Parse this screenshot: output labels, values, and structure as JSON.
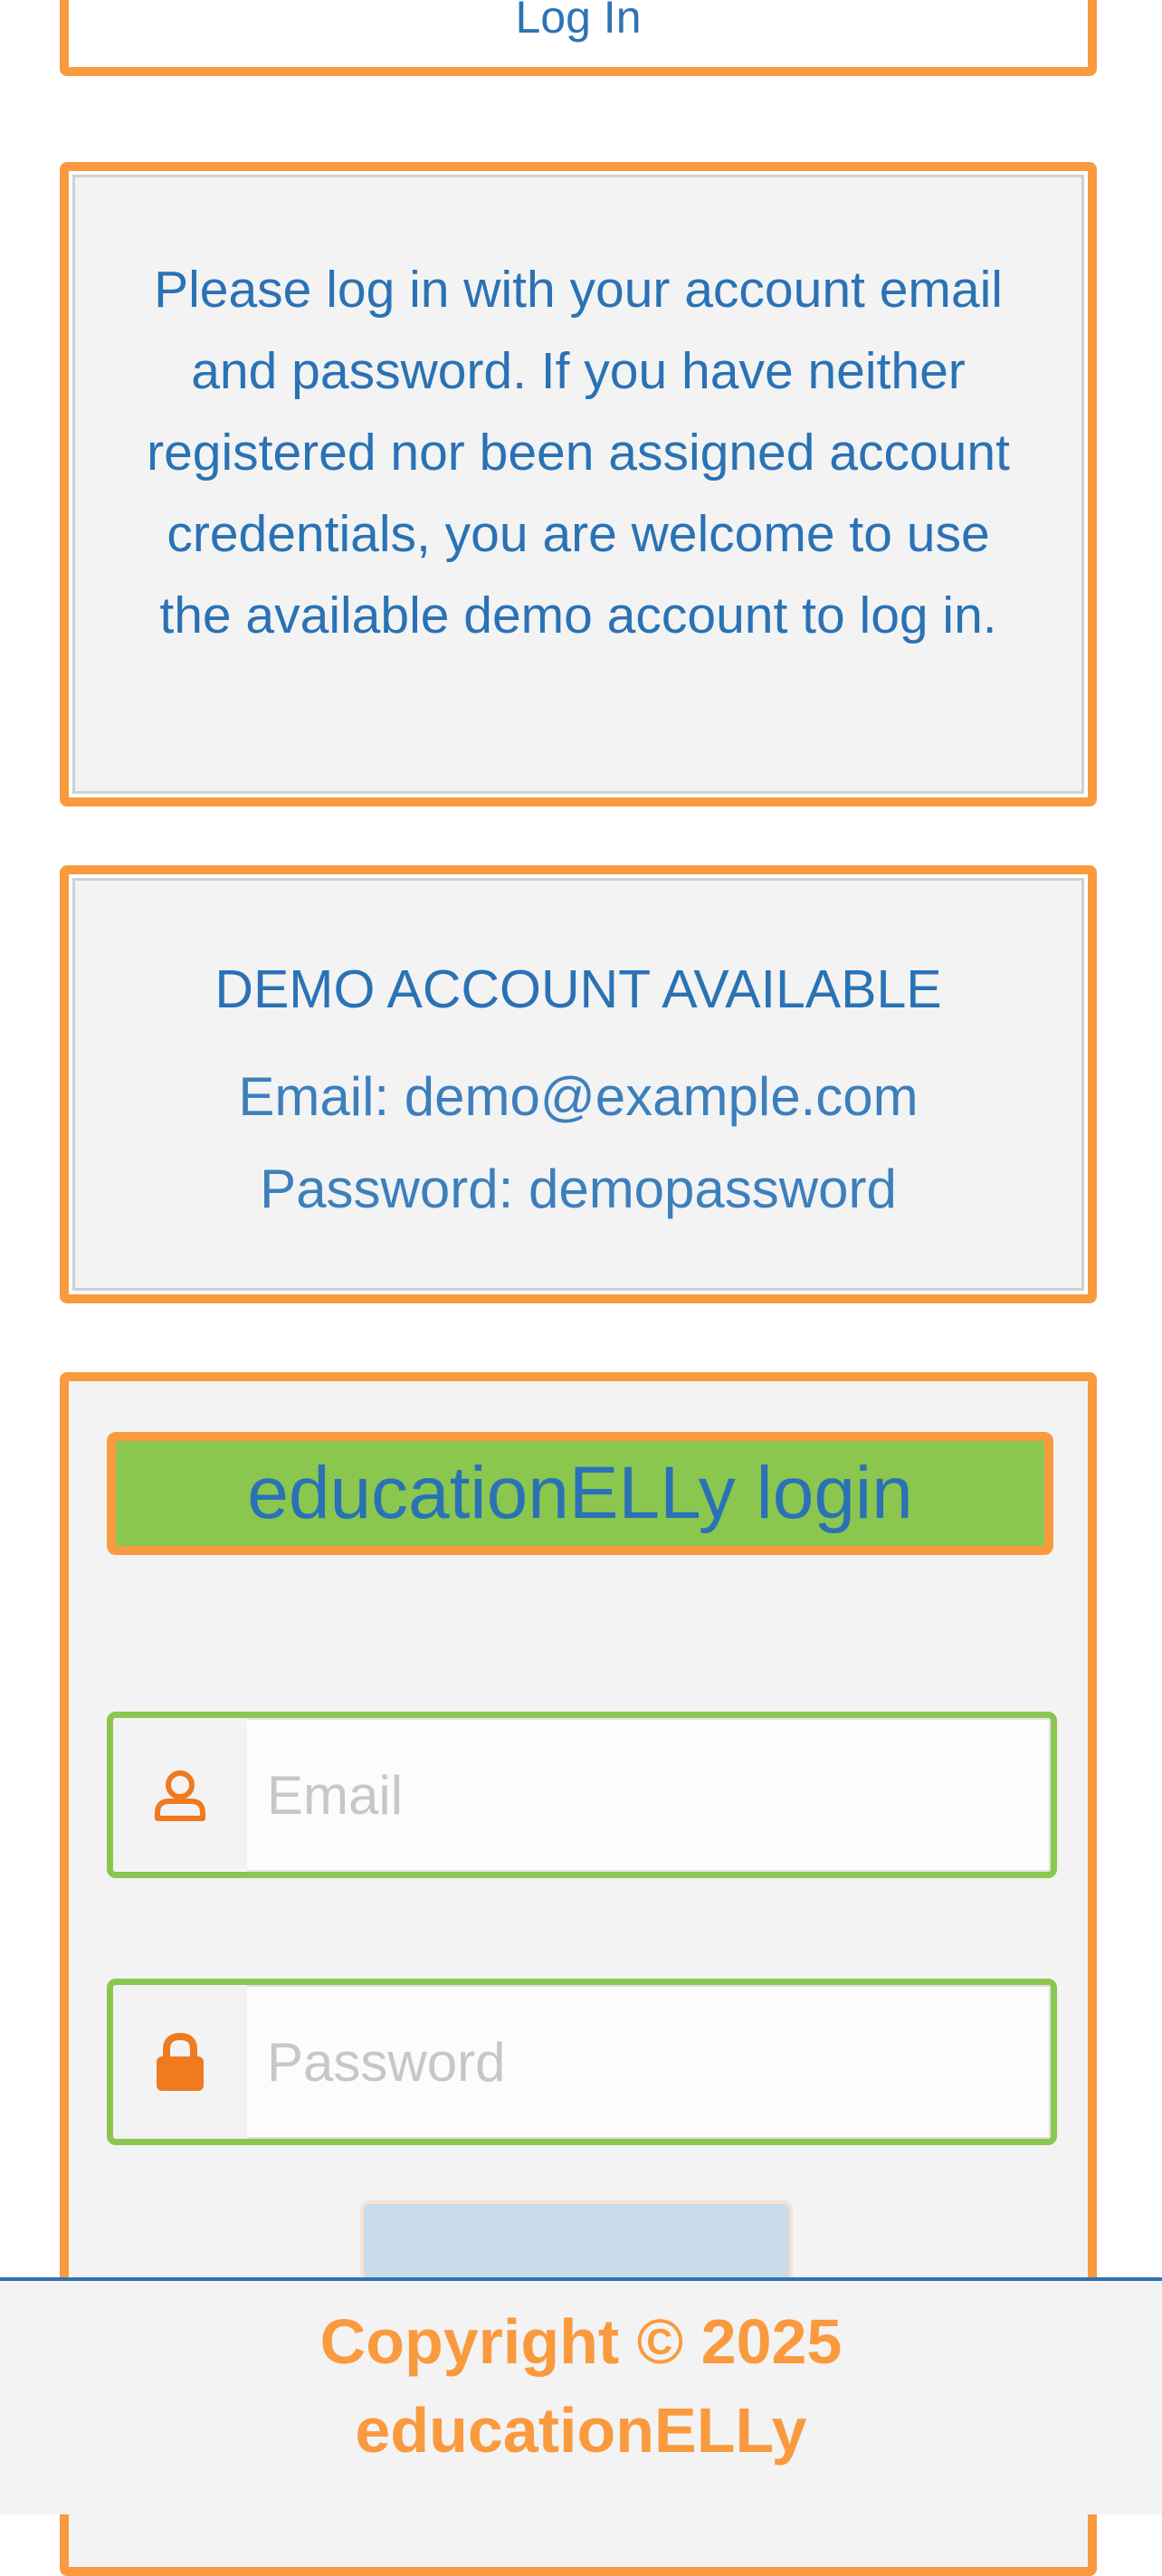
{
  "top_button": {
    "label": "Log In"
  },
  "info": {
    "text": "Please log in with your account email and password. If you have neither registered nor been assigned account credentials, you are welcome to use the available demo account to log in."
  },
  "demo": {
    "heading": "DEMO ACCOUNT AVAILABLE",
    "email_line": "Email: demo@example.com",
    "password_line": "Password: demopassword"
  },
  "login_form": {
    "heading": "educationELLy login",
    "email": {
      "placeholder": "Email",
      "value": "",
      "icon": "user-icon"
    },
    "password": {
      "placeholder": "Password",
      "value": "",
      "icon": "lock-icon"
    },
    "submit_label": ""
  },
  "footer": {
    "line1": "Copyright © 2025",
    "line2": "educationELLy"
  },
  "colors": {
    "accent_orange": "#fa9a3f",
    "accent_green": "#8bc64f",
    "text_blue": "#2a72b5",
    "icon_orange": "#f07a20"
  }
}
